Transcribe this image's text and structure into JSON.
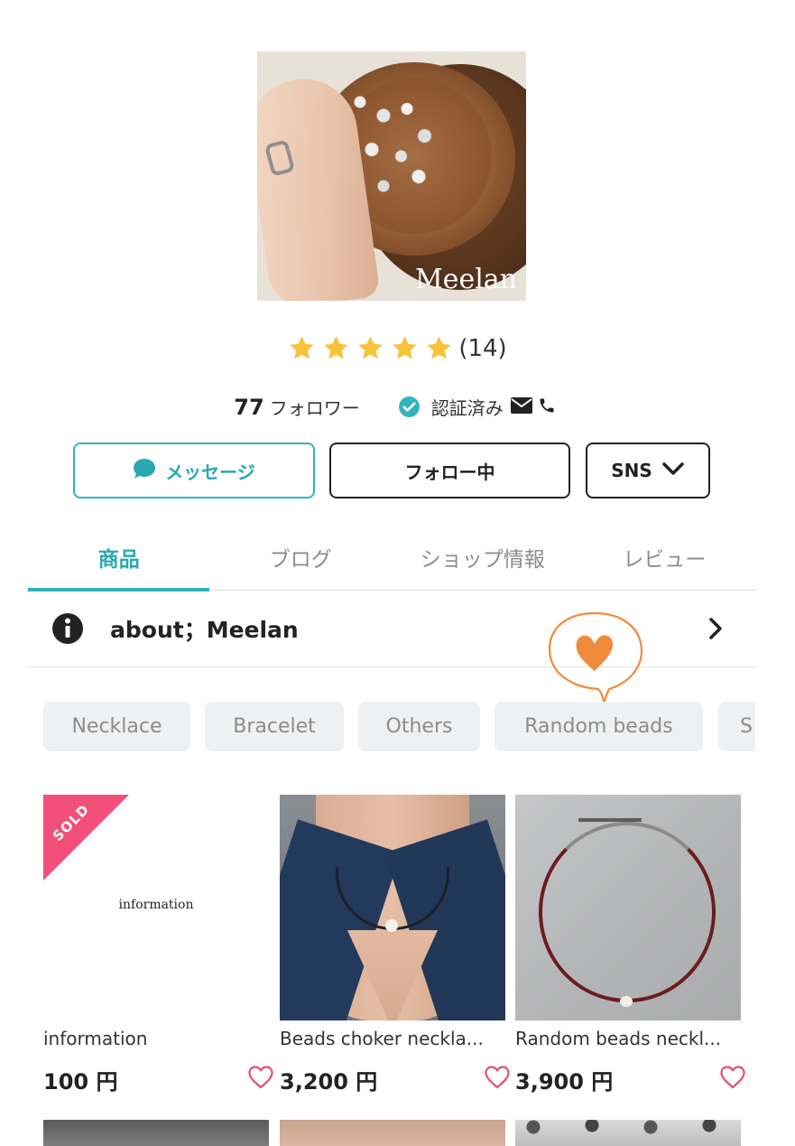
{
  "shop": {
    "logo_text": "Meelan",
    "rating": {
      "stars": 5,
      "count_text": "(14)"
    },
    "followers_count": "77",
    "followers_label": "フォロワー",
    "verified_label": "認証済み"
  },
  "actions": {
    "message_label": "メッセージ",
    "follow_label": "フォロー中",
    "sns_label": "SNS"
  },
  "tabs": [
    {
      "label": "商品",
      "active": true
    },
    {
      "label": "ブログ",
      "active": false
    },
    {
      "label": "ショップ情報",
      "active": false
    },
    {
      "label": "レビュー",
      "active": false
    }
  ],
  "about": {
    "label": "about；Meelan"
  },
  "categories": [
    "Necklace",
    "Bracelet",
    "Others",
    "Random beads",
    "S"
  ],
  "products": [
    {
      "title": "information",
      "price": "100 円",
      "badge": "SOLD",
      "image_text": "information"
    },
    {
      "title": "Beads choker neckla...",
      "price": "3,200 円"
    },
    {
      "title": "Random beads neckl...",
      "price": "3,900 円"
    }
  ],
  "colors": {
    "accent": "#32b4bd",
    "star": "#f7c33a",
    "sold_badge": "#f24f79",
    "heart_outline": "#e5506d",
    "doodle": "#f28a3c"
  }
}
